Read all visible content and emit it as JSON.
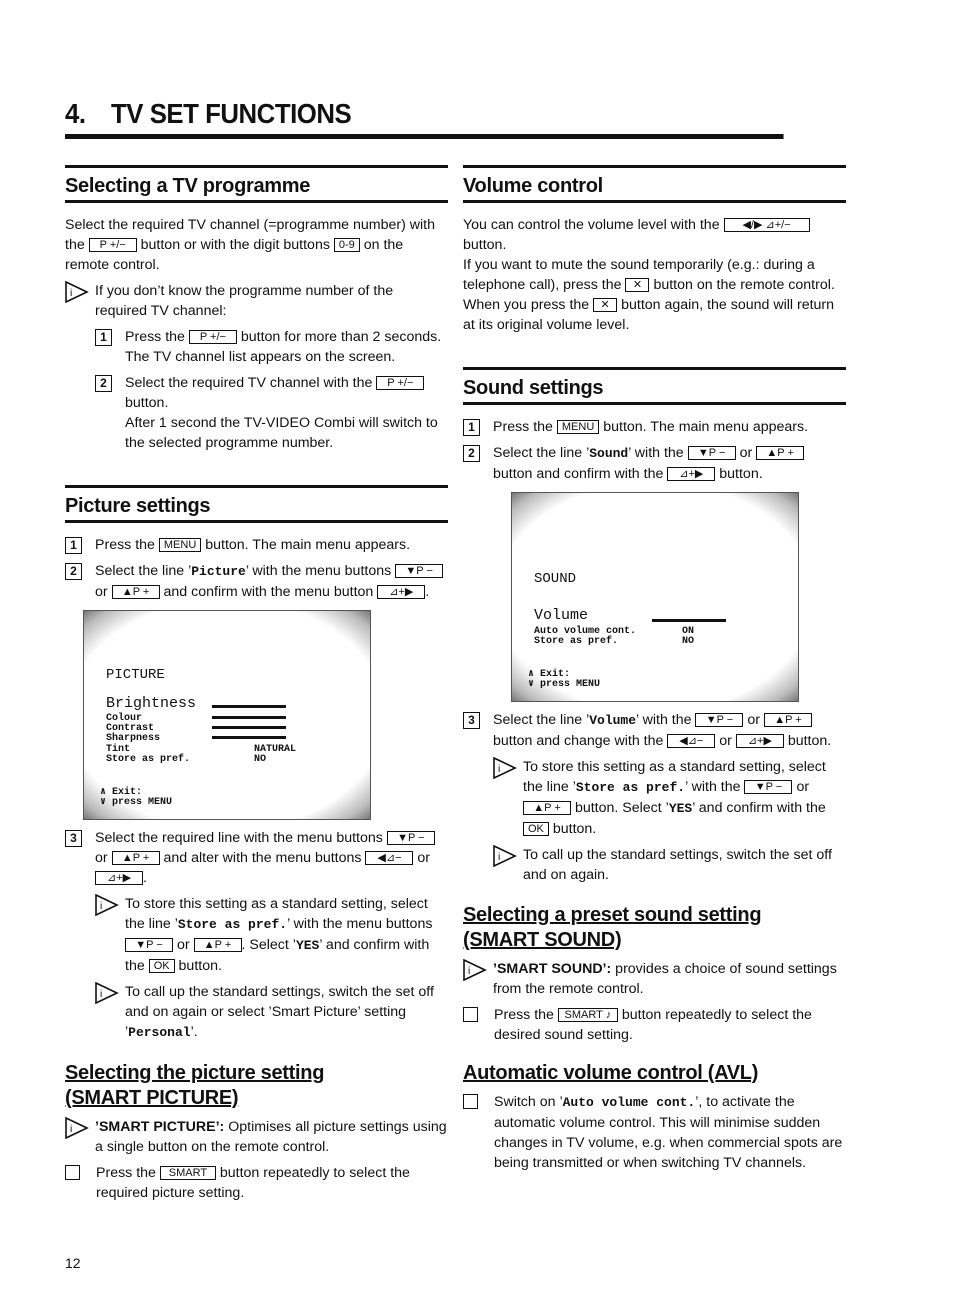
{
  "page": {
    "chapter_number": "4.",
    "chapter_title": "TV SET FUNCTIONS",
    "page_number": "12"
  },
  "buttons": {
    "p_plus_minus": "P +/−",
    "digits": "0-9",
    "menu": "MENU",
    "p_minus": "▼P −",
    "p_plus": "▲P +",
    "vol_plus": "⊿+▶",
    "vol_minus": "◀⊿−",
    "ok": "OK",
    "smart": "SMART",
    "smart_sound": "SMART ♪",
    "vol_lr": "◀/▶ ⊿+/−",
    "mute": "🔇"
  },
  "selecting_programme": {
    "heading": "Selecting a TV programme",
    "intro_a": "Select the required TV channel (=programme number) with the",
    "intro_b": "button or with the digit buttons",
    "intro_c": "on the remote control.",
    "info": "If you don’t know the programme number of the required TV channel:",
    "steps": [
      {
        "num": "1",
        "a": "Press the",
        "b": "button for more than 2 seconds. The TV channel list appears on the screen."
      },
      {
        "num": "2",
        "a": "Select the required TV channel with the",
        "b": "button.",
        "c": "After 1 second the TV-VIDEO Combi will switch to the selected programme number."
      }
    ]
  },
  "picture_settings": {
    "heading": "Picture settings",
    "step1": {
      "num": "1",
      "a": "Press the",
      "b": "button. The main menu appears."
    },
    "step2": {
      "num": "2",
      "a": "Select the line ’",
      "code": "Picture",
      "b": "’ with the menu buttons",
      "or": "or",
      "c": "and confirm with the menu button",
      "end": "."
    },
    "tv_menu": {
      "title": "PICTURE",
      "items": [
        {
          "label": "Brightness",
          "value_type": "bar"
        },
        {
          "label": "Colour",
          "value_type": "bar"
        },
        {
          "label": "Contrast",
          "value_type": "bar"
        },
        {
          "label": "Sharpness",
          "value_type": "bar"
        },
        {
          "label": "Tint",
          "value": "NATURAL"
        },
        {
          "label": "Store as pref.",
          "value": "NO"
        }
      ],
      "footer1": "∧ Exit:",
      "footer2": "∨ press MENU"
    },
    "step3": {
      "num": "3",
      "a": "Select the required line with the menu buttons",
      "or": "or",
      "b": "and alter with the menu buttons",
      "end": "."
    },
    "info1": {
      "a": "To store this setting as a standard setting, select the line ’",
      "code": "Store as pref.",
      "b": "’ with the menu buttons",
      "or": "or",
      "c": ". Select ’",
      "code2": "YES",
      "d": "’ and confirm with the",
      "e": "button."
    },
    "info2": {
      "a": "To call up the standard settings, switch the set off and on again or select ’Smart Picture’ setting ’",
      "code": "Personal",
      "b": "’."
    }
  },
  "smart_picture": {
    "heading1": "Selecting the picture setting",
    "heading2": "(SMART PICTURE)",
    "info_bold": "’SMART PICTURE’:",
    "info_text": " Optimises all picture settings using a single button on the remote control.",
    "step_a": "Press the",
    "step_b": "button repeatedly to select the required picture setting."
  },
  "volume_control": {
    "heading": "Volume control",
    "p1_a": "You can control the volume level with the",
    "p1_b": "button.",
    "p2_a": "If you want to mute the sound temporarily (e.g.: during a telephone call), press the",
    "p2_b": "button on the remote control.",
    "p3_a": "When you press the",
    "p3_b": "button again, the sound will return at its original volume level."
  },
  "sound_settings": {
    "heading": "Sound settings",
    "step1": {
      "num": "1",
      "a": "Press the",
      "b": "button. The main menu appears."
    },
    "step2": {
      "num": "2",
      "a": "Select the line ’",
      "code": "Sound",
      "b": "’ with the",
      "or": "or",
      "c": "button and confirm with the",
      "d": "button."
    },
    "tv_menu": {
      "title": "SOUND",
      "items": [
        {
          "label": "Volume",
          "value_type": "bar"
        },
        {
          "label": "Auto volume cont.",
          "value": "ON"
        },
        {
          "label": "Store as pref.",
          "value": "NO"
        }
      ],
      "footer1": "∧ Exit:",
      "footer2": "∨ press MENU"
    },
    "step3": {
      "num": "3",
      "a": "Select the line ’",
      "code": "Volume",
      "b": "’ with the",
      "or": "or",
      "c": "button and change with the",
      "d": "button."
    },
    "info1": {
      "a": "To store this setting as a standard setting, select the line ’",
      "code": "Store as pref.",
      "b": "’ with the",
      "or": "or",
      "c": "button. Select ’",
      "code2": "YES",
      "d": "’ and confirm with the",
      "e": "button."
    },
    "info2": "To call up the standard settings, switch the set off and on again."
  },
  "smart_sound": {
    "heading1": "Selecting a preset sound setting",
    "heading2": "(SMART SOUND)",
    "info_bold": "’SMART SOUND’:",
    "info_text": " provides a choice of sound settings from the remote control.",
    "step_a": "Press the",
    "step_b": "button repeatedly to select the desired sound setting."
  },
  "avl": {
    "heading": "Automatic volume control (AVL)",
    "a": "Switch on ’",
    "code": "Auto volume cont.",
    "b": "’, to activate the automatic volume control. This will minimise sudden changes in TV volume, e.g. when commercial spots are being transmitted or when switching TV channels."
  }
}
